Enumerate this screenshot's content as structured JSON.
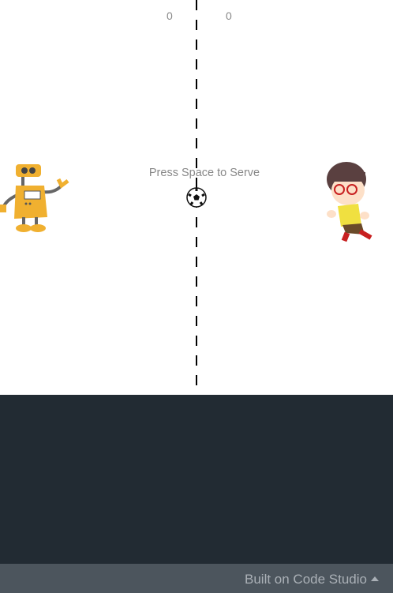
{
  "game": {
    "score_left": "0",
    "score_right": "0",
    "message": "Press Space to Serve",
    "left_paddle": "robot-sprite",
    "right_paddle": "boy-sprite",
    "ball": "soccer-ball-icon"
  },
  "footer": {
    "label": "Built on Code Studio",
    "icon": "caret-up-icon"
  }
}
